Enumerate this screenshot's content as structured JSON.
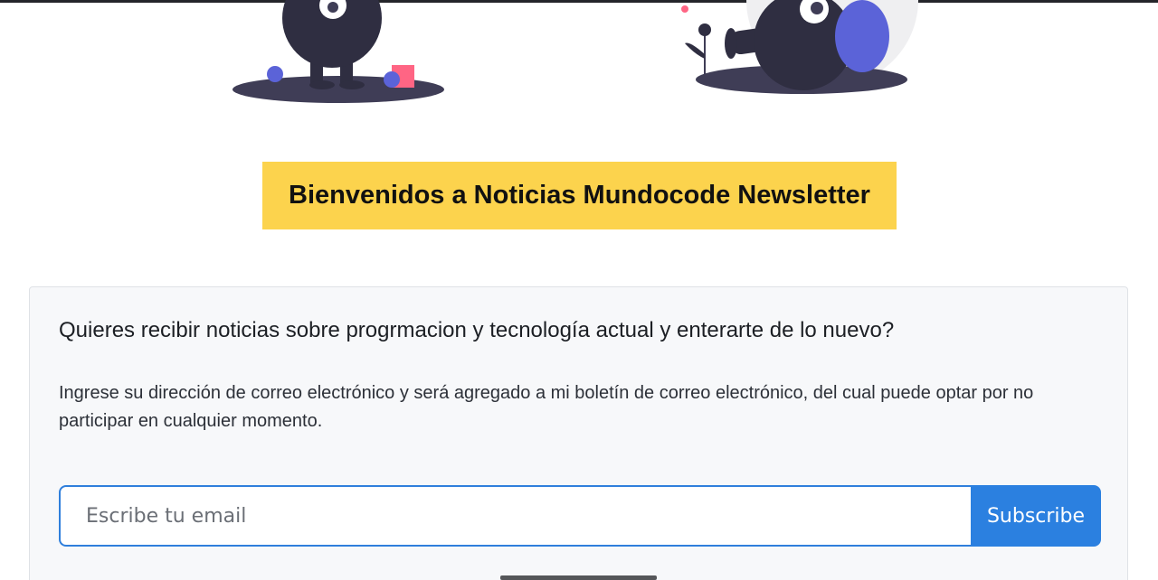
{
  "header": {
    "title": "Bienvenidos a Noticias Mundocode Newsletter"
  },
  "newsletter": {
    "question": "Quieres recibir noticias sobre progrmacion y tecnología actual y enterarte de lo nuevo?",
    "description": "Ingrese su dirección de correo electrónico y será agregado a mi boletín de correo electrónico, del cual puede optar por no participar en cualquier momento.",
    "email_placeholder": "Escribe tu email",
    "email_value": "",
    "subscribe_label": "Subscribe"
  },
  "colors": {
    "banner": "#fcd34d",
    "accent": "#2b80e0",
    "card_bg": "#f7f8fa",
    "character_dark": "#2f2e41",
    "character_blue": "#5b63d8",
    "character_pink": "#ff6584"
  },
  "icons": {
    "left_illustration": "monster-character-illustration",
    "right_illustration": "monster-character-lying-illustration"
  }
}
